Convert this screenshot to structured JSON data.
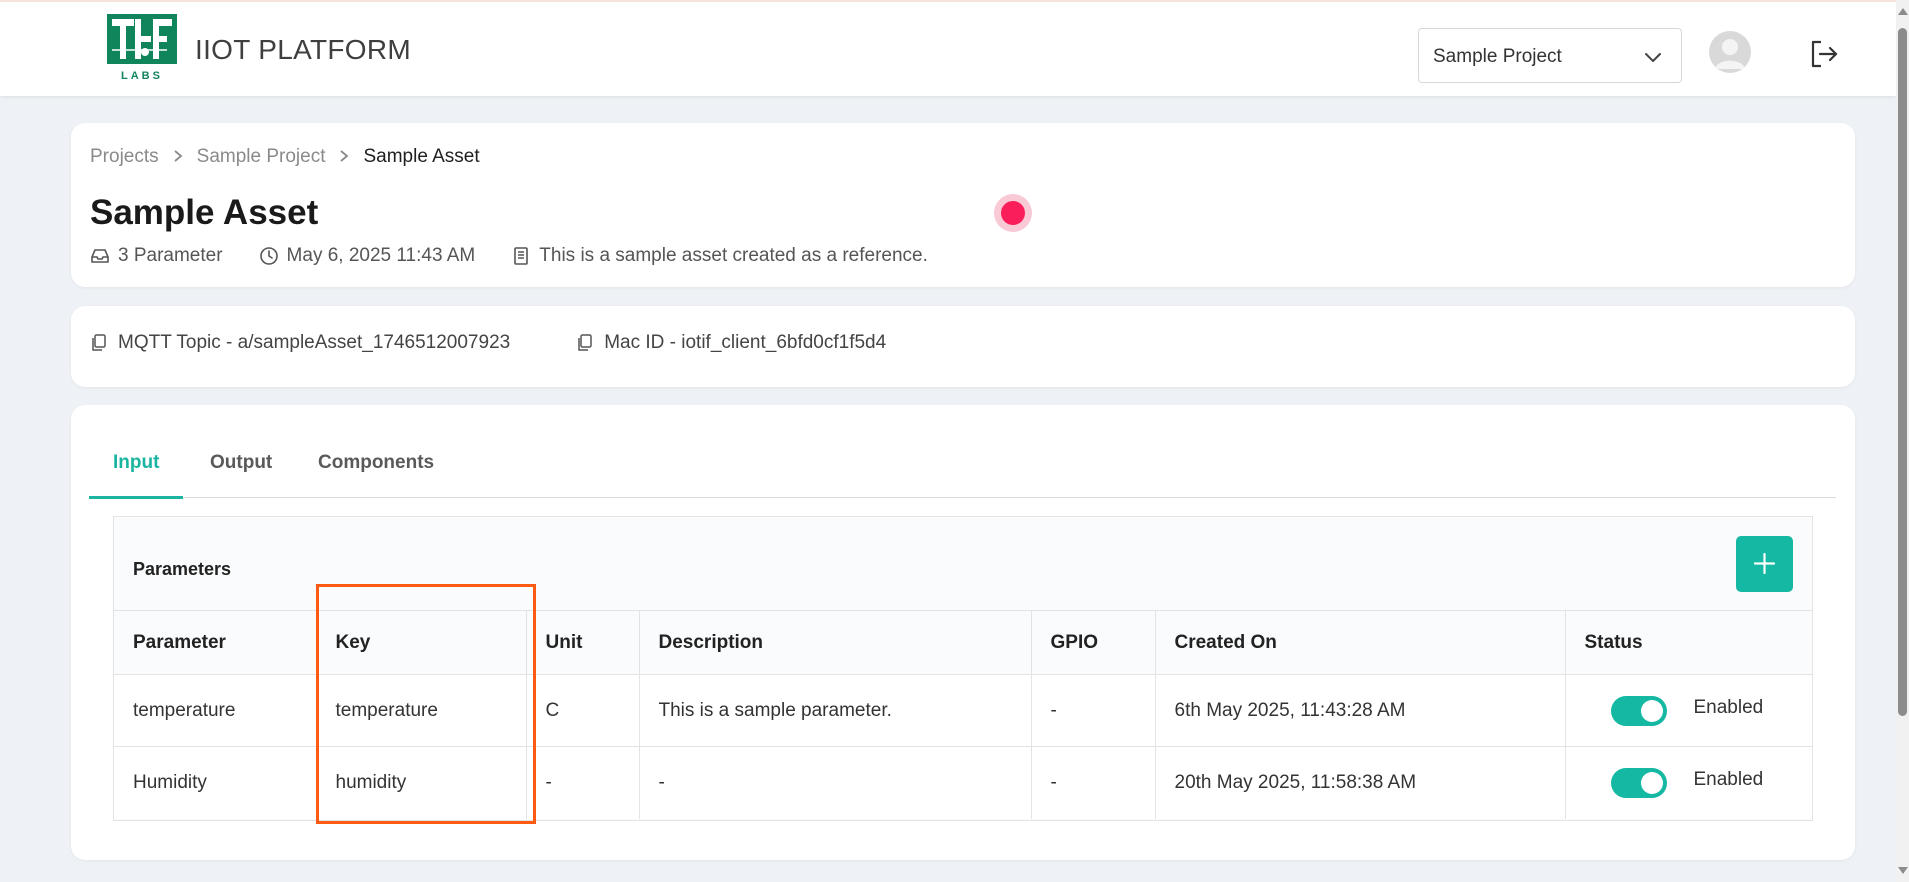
{
  "header": {
    "brand": "IIOT PLATFORM",
    "logo_caption": "LABS",
    "project_select": {
      "value": "Sample Project"
    }
  },
  "breadcrumb": {
    "items": [
      "Projects",
      "Sample Project",
      "Sample Asset"
    ],
    "separator": ">"
  },
  "asset": {
    "title": "Sample Asset",
    "param_count": "3 Parameter",
    "created": "May 6, 2025 11:43 AM",
    "description": "This is a sample asset created as a reference.",
    "mqtt_topic": "MQTT Topic - a/sampleAsset_1746512007923",
    "mac_id": "Mac ID - iotif_client_6bfd0cf1f5d4"
  },
  "tabs": [
    {
      "label": "Input",
      "active": true
    },
    {
      "label": "Output",
      "active": false
    },
    {
      "label": "Components",
      "active": false
    }
  ],
  "parameters": {
    "title": "Parameters",
    "columns": [
      "Parameter",
      "Key",
      "Unit",
      "Description",
      "GPIO",
      "Created On",
      "Status"
    ],
    "rows": [
      {
        "parameter": "temperature",
        "key": "temperature",
        "unit": "C",
        "description": "This is a sample parameter.",
        "gpio": "-",
        "created_on": "6th May 2025, 11:43:28 AM",
        "status": "Enabled"
      },
      {
        "parameter": "Humidity",
        "key": "humidity",
        "unit": "-",
        "description": "-",
        "gpio": "-",
        "created_on": "20th May 2025, 11:58:38 AM",
        "status": "Enabled"
      }
    ]
  },
  "colors": {
    "accent": "#15b8a3",
    "highlight": "#ff5a12",
    "record": "#fa1e5a"
  }
}
